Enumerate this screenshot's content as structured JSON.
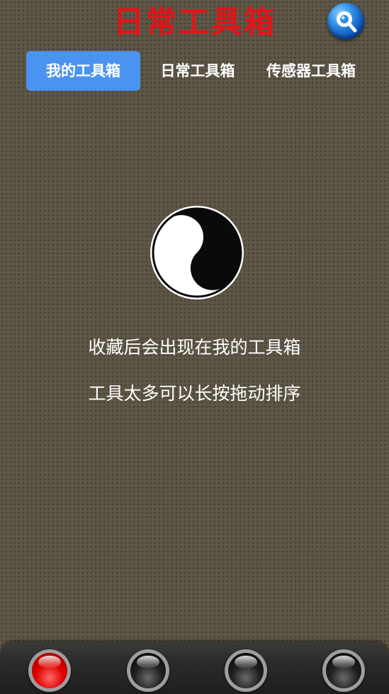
{
  "header": {
    "title": "日常工具箱",
    "title_color": "#e0141a",
    "search_icon": "search-icon"
  },
  "tabs": [
    {
      "label": "我的工具箱",
      "active": true
    },
    {
      "label": "日常工具箱",
      "active": false
    },
    {
      "label": "传感器工具箱",
      "active": false
    }
  ],
  "main": {
    "icon": "yin-yang-icon",
    "hint_line_1": "收藏后会出现在我的工具箱",
    "hint_line_2": "工具太多可以长按拖动排序"
  },
  "bottom_nav": {
    "buttons": [
      {
        "icon": "red-orb-icon",
        "active": true,
        "color": "#e00000"
      },
      {
        "icon": "black-orb-icon",
        "active": false,
        "color": "#101010"
      },
      {
        "icon": "black-orb-icon",
        "active": false,
        "color": "#101010"
      },
      {
        "icon": "black-orb-icon",
        "active": false,
        "color": "#101010"
      }
    ]
  },
  "colors": {
    "background": "#5c5545",
    "tab_active": "#4b93f0",
    "text": "#ffffff"
  }
}
